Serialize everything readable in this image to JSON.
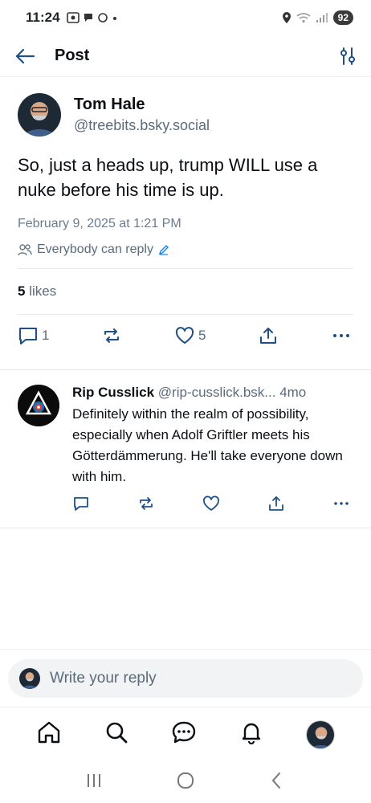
{
  "status": {
    "time": "11:24",
    "battery": "92"
  },
  "header": {
    "title": "Post"
  },
  "post": {
    "author_name": "Tom Hale",
    "author_handle": "@treebits.bsky.social",
    "text": "So, just a heads up,  trump WILL use a nuke before his time is up.",
    "date": "February 9, 2025 at 1:21 PM",
    "reply_setting": "Everybody can reply",
    "likes_count": "5",
    "likes_label": " likes",
    "reply_count": "1",
    "like_count": "5"
  },
  "reply": {
    "author_name": "Rip Cusslick",
    "author_handle": "@rip-cusslick.bsk...",
    "age": "4mo",
    "text": "Definitely within the realm of possibility, especially when Adolf Griftler meets his Götterdämmerung. He'll take everyone down with him."
  },
  "compose": {
    "placeholder": "Write your reply"
  },
  "colors": {
    "accent": "#1083fe",
    "muted": "#5b6b7b",
    "text": "#0b0f14"
  }
}
